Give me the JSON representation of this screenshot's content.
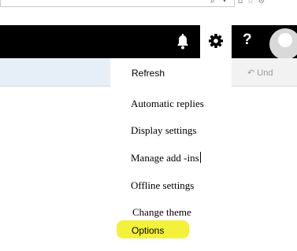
{
  "header": {
    "help_label": "?"
  },
  "toolbar": {
    "undo_label": "Und"
  },
  "settings_menu": {
    "refresh": "Refresh",
    "automatic_replies": "Automatic replies",
    "display_settings": "Display settings",
    "manage_addins": "Manage add -ins",
    "offline_settings": "Offline settings",
    "change_theme": "Change theme",
    "options": "Options"
  },
  "colors": {
    "header_bg": "#000000",
    "highlight": "#f4f13a"
  },
  "icons": [
    "search-icon",
    "dropdown-caret-icon",
    "home-icon",
    "favorites-icon",
    "tools-icon",
    "bell-icon",
    "gear-icon",
    "help-icon",
    "avatar",
    "undo-icon"
  ]
}
